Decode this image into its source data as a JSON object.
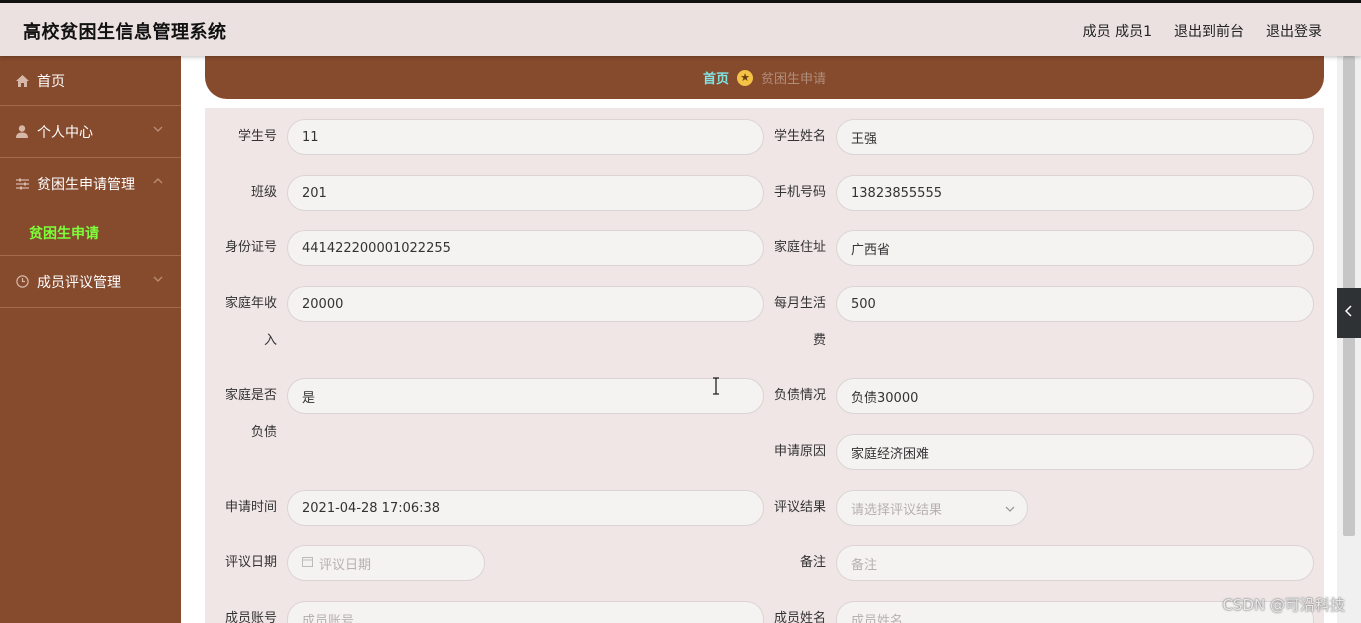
{
  "header": {
    "app_title": "高校贫困生信息管理系统",
    "user_label": "成员 成员1",
    "back_to_front": "退出到前台",
    "logout": "退出登录"
  },
  "sidebar": {
    "items": [
      {
        "label": "首页",
        "icon": "home-icon"
      },
      {
        "label": "个人中心",
        "icon": "user-icon"
      },
      {
        "label": "贫困生申请管理",
        "icon": "sliders-icon"
      },
      {
        "label": "成员评议管理",
        "icon": "clock-icon"
      }
    ],
    "submenu_active": "贫困生申请"
  },
  "breadcrumb": {
    "home": "首页",
    "current": "贫困生申请"
  },
  "form": {
    "student_no": {
      "label": "学生号",
      "value": "11"
    },
    "student_name": {
      "label": "学生姓名",
      "value": "王强"
    },
    "class": {
      "label": "班级",
      "value": "201"
    },
    "phone": {
      "label": "手机号码",
      "value": "13823855555"
    },
    "id_card": {
      "label": "身份证号",
      "value": "441422200001022255"
    },
    "address": {
      "label": "家庭住址",
      "value": "广西省"
    },
    "income": {
      "label_1": "家庭年收",
      "label_2": "入",
      "value": "20000"
    },
    "monthly_cost": {
      "label_1": "每月生活",
      "label_2": "费",
      "value": "500"
    },
    "in_debt": {
      "label_1": "家庭是否",
      "label_2": "负债",
      "value": "是"
    },
    "debt_detail": {
      "label": "负债情况",
      "value": "负债30000"
    },
    "reason": {
      "label": "申请原因",
      "value": "家庭经济困难"
    },
    "apply_time": {
      "label": "申请时间",
      "value": "2021-04-28 17:06:38"
    },
    "review_result": {
      "label": "评议结果",
      "placeholder": "请选择评议结果"
    },
    "review_date": {
      "label": "评议日期",
      "placeholder": "评议日期"
    },
    "remark": {
      "label": "备注",
      "placeholder": "备注"
    },
    "member_account": {
      "label": "成员账号",
      "placeholder": "成员账号"
    },
    "member_name": {
      "label": "成员姓名",
      "placeholder": "成员姓名"
    }
  },
  "watermark": "CSDN @可沿科技",
  "colors": {
    "sidebar_bg": "#864a2d",
    "header_bg": "#ebe1e1",
    "active_submenu": "#7cff3a",
    "breadcrumb_home": "#7fe5e5"
  }
}
